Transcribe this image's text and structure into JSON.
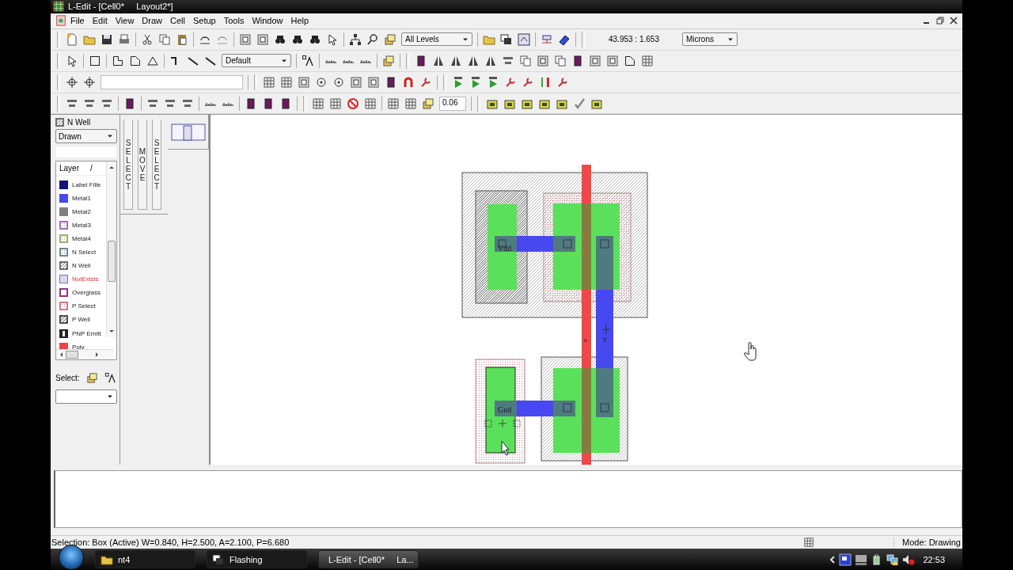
{
  "window": {
    "title": "L-Edit - [Cell0*     Layout2*]"
  },
  "menu": [
    "File",
    "Edit",
    "View",
    "Draw",
    "Cell",
    "Setup",
    "Tools",
    "Window",
    "Help"
  ],
  "toolbar": {
    "levels": "All Levels",
    "coordinates": "43.953 : 1.653",
    "units": "Microns",
    "style": "Default",
    "grid_value": "0.06"
  },
  "layer_palette": {
    "current_layer": "N Well",
    "mode": "Drawn",
    "header": "Layer",
    "sort_mark": "/",
    "select_label": "Select:",
    "layers": [
      {
        "name": "Label Fille",
        "color": "#12127a",
        "kind": "solid",
        "missing": false
      },
      {
        "name": "Metal1",
        "color": "#4848f4",
        "kind": "solid",
        "missing": false
      },
      {
        "name": "Metal2",
        "color": "#808080",
        "kind": "solid",
        "missing": false
      },
      {
        "name": "Metal3",
        "color": "#a070b0",
        "kind": "dots",
        "missing": false
      },
      {
        "name": "Metal4",
        "color": "#a0a870",
        "kind": "dots",
        "missing": false
      },
      {
        "name": "N Select",
        "color": "#6a8a8a",
        "kind": "dots",
        "missing": false
      },
      {
        "name": "N Well",
        "color": "#707070",
        "kind": "hatch",
        "missing": false
      },
      {
        "name": "NotExists",
        "color": "#d8d8f0",
        "kind": "outline",
        "missing": true
      },
      {
        "name": "Overglass",
        "color": "#8a3a80",
        "kind": "cross",
        "missing": false
      },
      {
        "name": "P Select",
        "color": "#d07890",
        "kind": "dots",
        "missing": false
      },
      {
        "name": "P Well",
        "color": "#505050",
        "kind": "hatch",
        "missing": false
      },
      {
        "name": "PNP Emitt",
        "color": "#222222",
        "kind": "bars",
        "missing": false
      },
      {
        "name": "Poly",
        "color": "#f04444",
        "kind": "solid",
        "missing": false
      }
    ]
  },
  "mode_buttons": [
    "SELECT",
    "MOVE",
    "SELECT"
  ],
  "layout": {
    "labels": [
      {
        "text": "Vdd"
      },
      {
        "text": "Gnd"
      },
      {
        "text": "a"
      },
      {
        "text": "Y"
      }
    ]
  },
  "status_bar": {
    "selection": "Selection: Box (Active) W=0.840, H=2.500, A=2.100, P=6.680",
    "mode": "Mode: Drawing"
  },
  "taskbar": {
    "buttons": [
      {
        "label": "nt4",
        "selected": false
      },
      {
        "label": "Flashing",
        "selected": false
      },
      {
        "label": "L-Edit - [Cell0*     La...",
        "selected": true
      }
    ],
    "clock": "22:53"
  }
}
